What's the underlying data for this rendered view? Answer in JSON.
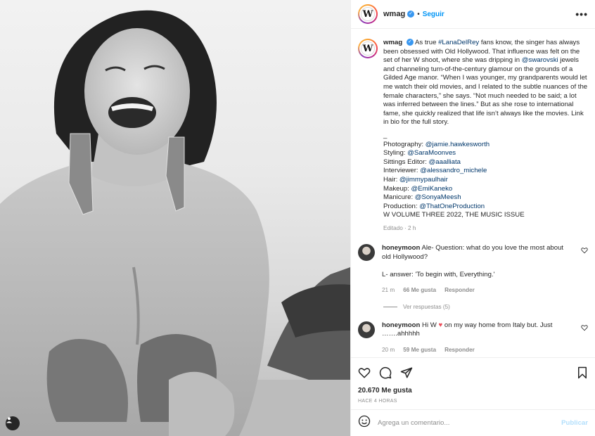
{
  "post": {
    "username": "wmag",
    "avatar_letter": "W",
    "verified_mark": "✓",
    "dot": "•",
    "follow_label": "Seguir",
    "more_label": "•••"
  },
  "caption": {
    "username": "wmag",
    "lines": [
      "As true ",
      "#LanaDelRey",
      " fans know, the singer has always been obsessed with Old Hollywood. That influence was felt on the set of her W shoot, where she was dripping in ",
      "@swarovski",
      " jewels and channeling turn-of-the-century glamour on the grounds of a Gilded Age manor. “When I was younger, my grandparents would let me watch their old movies, and I related to the subtle nuances of the female characters,” she says. “Not much needed to be said; a lot was inferred between the lines.” But as she rose to international fame, she quickly realized that life isn’t always like the movies. Link in bio for the full story."
    ],
    "separator": "_",
    "credits": [
      {
        "label": "Photography: ",
        "handle": "@jamie.hawkesworth"
      },
      {
        "label": "Styling: ",
        "handle": "@SaraMoonves"
      },
      {
        "label": "Sittings Editor: ",
        "handle": "@aaalliata"
      },
      {
        "label": "Interviewer: ",
        "handle": "@alessandro_michele"
      },
      {
        "label": "Hair: ",
        "handle": "@jimmypaulhair"
      },
      {
        "label": "Makeup: ",
        "handle": "@EmiKaneko"
      },
      {
        "label": "Manicure: ",
        "handle": "@SonyaMeesh"
      },
      {
        "label": "Production: ",
        "handle": "@ThatOneProduction"
      }
    ],
    "issue": "W VOLUME THREE 2022, THE MUSIC ISSUE",
    "edited": "Editado · 2 h"
  },
  "comments": [
    {
      "username": "honeymoon",
      "text_1": "Ale- Question: what do you love the most about old Hollywood?",
      "text_2": "L- answer: 'To begin with, Everything.'",
      "time": "21 m",
      "likes": "66 Me gusta",
      "reply": "Responder",
      "view_replies": "Ver respuestas (5)"
    },
    {
      "username": "honeymoon",
      "text_pre": "Hi W ",
      "heart": "♥",
      "text_post": " on my way home from Italy but. Just …….ahhhhh",
      "time": "20 m",
      "likes": "59 Me gusta",
      "reply": "Responder"
    }
  ],
  "stats": {
    "likes": "20.670 Me gusta",
    "ago": "HACE 4 HORAS"
  },
  "composer": {
    "placeholder": "Agrega un comentario...",
    "publish": "Publicar"
  },
  "icons": {
    "like": "heart-icon",
    "comment": "comment-icon",
    "share": "share-icon",
    "save": "bookmark-icon",
    "emoji": "emoji-icon",
    "tag": "user-tag-icon"
  }
}
